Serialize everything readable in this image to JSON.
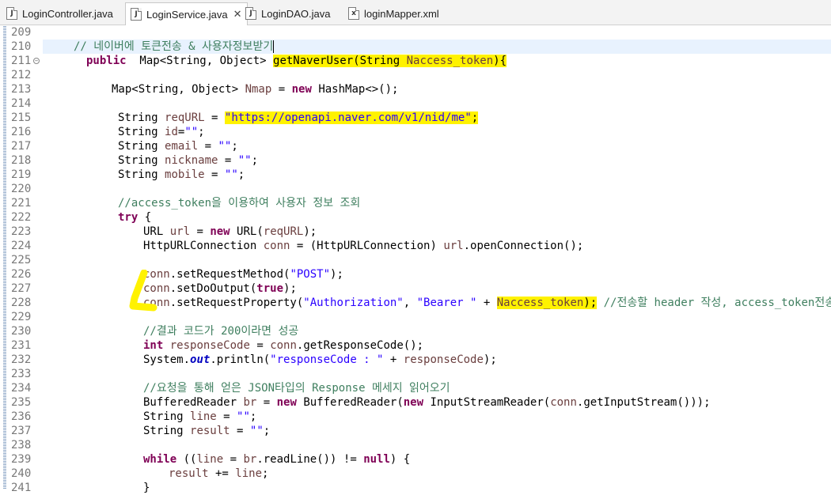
{
  "tabs": [
    {
      "label": "LoginController.java",
      "icon": "java-file-icon",
      "active": false
    },
    {
      "label": "LoginService.java",
      "icon": "java-file-icon",
      "active": true
    },
    {
      "label": "LoginDAO.java",
      "icon": "java-file-icon",
      "active": false
    },
    {
      "label": "loginMapper.xml",
      "icon": "xml-file-icon",
      "active": false
    }
  ],
  "tab_close_glyph": "✕",
  "highlight_color": "#fff200",
  "editor": {
    "line_numbers": [
      "209",
      "210",
      "211",
      "212",
      "213",
      "214",
      "215",
      "216",
      "217",
      "218",
      "219",
      "220",
      "221",
      "222",
      "223",
      "224",
      "225",
      "226",
      "227",
      "228",
      "229",
      "230",
      "231",
      "232",
      "233",
      "234",
      "235",
      "236",
      "237",
      "238",
      "239",
      "240",
      "241"
    ],
    "fold_marker_line": "211",
    "comments": {
      "l210": "// 네이버에 토큰전송 & 사용자정보받기",
      "l221": "//access_token을 이용하여 사용자 정보 조회",
      "l228": "//전송할 header 작성, access_token전송",
      "l230": "//결과 코드가 200이라면 성공",
      "l234": "//요청을 통해 얻은 JSON타입의 Response 메세지 읽어오기"
    },
    "strings": {
      "req_url": "\"https://openapi.naver.com/v1/nid/me\"",
      "empty": "\"\"",
      "post": "\"POST\"",
      "authorization": "\"Authorization\"",
      "bearer": "\"Bearer \"",
      "response_code": "\"responseCode : \""
    }
  }
}
